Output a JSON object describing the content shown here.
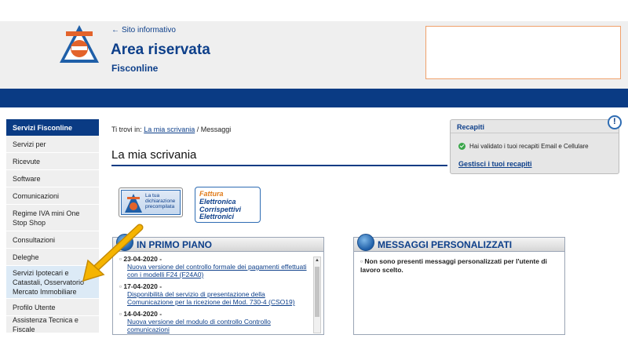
{
  "header": {
    "back_link": "Sito informativo",
    "title": "Area riservata",
    "subtitle": "Fisconline"
  },
  "sidebar": {
    "heading": "Servizi Fisconline",
    "items": [
      {
        "label": "Servizi per"
      },
      {
        "label": "Ricevute"
      },
      {
        "label": "Software"
      },
      {
        "label": "Comunicazioni"
      },
      {
        "label": "Regime IVA mini One Stop Shop"
      },
      {
        "label": "Consultazioni"
      },
      {
        "label": "Deleghe"
      },
      {
        "label": "Servizi Ipotecari e Catastali, Osservatorio Mercato Immobiliare"
      },
      {
        "label": "Profilo Utente"
      },
      {
        "label": "Assistenza Tecnica e Fiscale"
      }
    ]
  },
  "breadcrumb": {
    "prefix": "Ti trovi in:",
    "link": "La mia scrivania",
    "separator": "/",
    "current": "Messaggi"
  },
  "page_title": "La mia scrivania",
  "recapiti": {
    "title": "Recapiti",
    "message": "Hai validato i tuoi recapiti Email e Cellulare",
    "link": "Gestisci i tuoi recapiti"
  },
  "services": {
    "precompilata": [
      "La tua",
      "dichiarazione",
      "precompilata"
    ],
    "fattura_a": "Fattura",
    "fattura_b": "Elettronica",
    "corrisp_a": "Corrispettivi",
    "corrisp_b": "Elettronici"
  },
  "primo_piano": {
    "title": "IN PRIMO PIANO",
    "items": [
      {
        "date": "23-04-2020 -",
        "text": "Nuova versione del controllo formale dei pagamenti effettuati con i modelli F24 (F24A0)"
      },
      {
        "date": "17-04-2020 -",
        "text": "Disponibilità del servizio di presentazione della Comunicazione per la ricezione dei Mod. 730-4 (CSO19)"
      },
      {
        "date": "14-04-2020 -",
        "text": "Nuova versione del modulo di controllo Controllo comunicazioni"
      }
    ]
  },
  "messaggi": {
    "title": "MESSAGGI PERSONALIZZATI",
    "text": "Non sono presenti messaggi personalizzati per l'utente di lavoro scelto."
  },
  "colors": {
    "brand_blue": "#0a3b84",
    "link_blue": "#0d3f8a",
    "accent_orange": "#e07b1a",
    "arrow_yellow": "#f5b400"
  }
}
